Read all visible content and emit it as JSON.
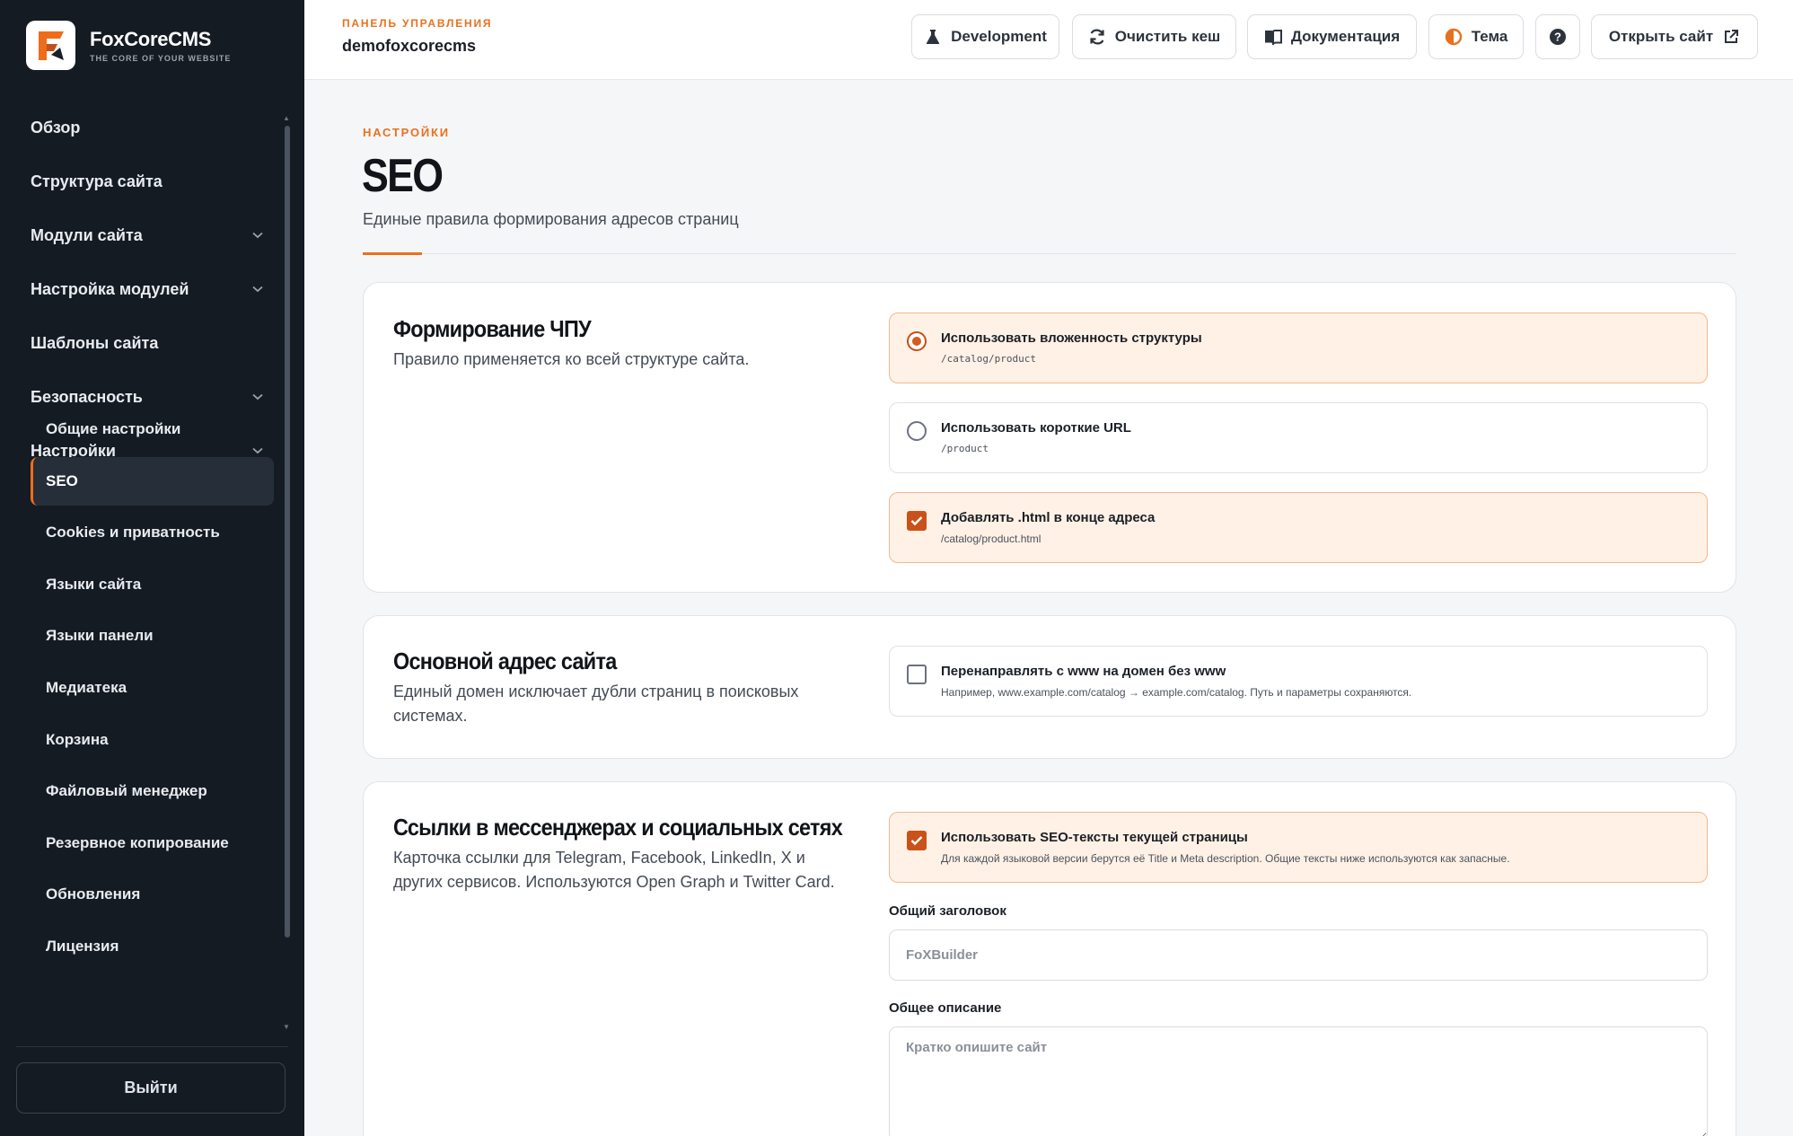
{
  "brand": {
    "name": "FoxCoreCMS",
    "tagline": "THE CORE OF YOUR WEBSITE"
  },
  "sidebar": {
    "items": [
      {
        "label": "Обзор"
      },
      {
        "label": "Структура сайта"
      },
      {
        "label": "Модули сайта"
      },
      {
        "label": "Настройка модулей"
      },
      {
        "label": "Шаблоны сайта"
      },
      {
        "label": "Безопасность"
      },
      {
        "label": "Настройки"
      }
    ],
    "subitems": [
      {
        "label": "Общие настройки"
      },
      {
        "label": "SEO"
      },
      {
        "label": "Cookies и приватность"
      },
      {
        "label": "Языки сайта"
      },
      {
        "label": "Языки панели"
      },
      {
        "label": "Медиатека"
      },
      {
        "label": "Корзина"
      },
      {
        "label": "Файловый менеджер"
      },
      {
        "label": "Резервное копирование"
      },
      {
        "label": "Обновления"
      },
      {
        "label": "Лицензия"
      }
    ],
    "active": "SEO",
    "logout_label": "Выйти"
  },
  "header": {
    "kicker": "ПАНЕЛЬ УПРАВЛЕНИЯ",
    "site": "demofoxcorecms",
    "buttons": {
      "development": "Development",
      "clear_cache": "Очистить кеш",
      "docs": "Документация",
      "theme": "Тема",
      "open_site": "Открыть сайт"
    }
  },
  "page": {
    "kicker": "НАСТРОЙКИ",
    "title": "SEO",
    "subtitle": "Единые правила формирования адресов страниц"
  },
  "sections": {
    "urls": {
      "title": "Формирование ЧПУ",
      "desc": "Правило применяется ко всей структуре сайта.",
      "options": [
        {
          "label": "Использовать вложенность структуры",
          "hint": "/catalog/product",
          "selected": true
        },
        {
          "label": "Использовать короткие URL",
          "hint": "/product",
          "selected": false
        }
      ],
      "html_suffix": {
        "label": "Добавлять .html в конце адреса",
        "hint": "/catalog/product.html",
        "checked": true
      }
    },
    "domain": {
      "title": "Основной адрес сайта",
      "desc": "Единый домен исключает дубли страниц в поисковых системах.",
      "redirect": {
        "label": "Перенаправлять с www на домен без www",
        "hint": "Например, www.example.com/catalog → example.com/catalog. Путь и параметры сохраняются.",
        "checked": false
      }
    },
    "social": {
      "title": "Ссылки в мессенджерах и социальных сетях",
      "desc": "Карточка ссылки для Telegram, Facebook, LinkedIn, X и других сервисов. Используются Open Graph и Twitter Card.",
      "use_page_seo": {
        "label": "Использовать SEO-тексты текущей страницы",
        "hint": "Для каждой языковой версии берутся её Title и Meta description. Общие тексты ниже используются как запасные.",
        "checked": true
      },
      "title_field": {
        "label": "Общий заголовок",
        "placeholder": "FoXBuilder"
      },
      "desc_field": {
        "label": "Общее описание",
        "placeholder": "Кратко опишите сайт"
      }
    }
  },
  "colors": {
    "accent": "#e8711f",
    "sidebar_bg": "#151b23",
    "selected_bg": "#fff1e6"
  }
}
